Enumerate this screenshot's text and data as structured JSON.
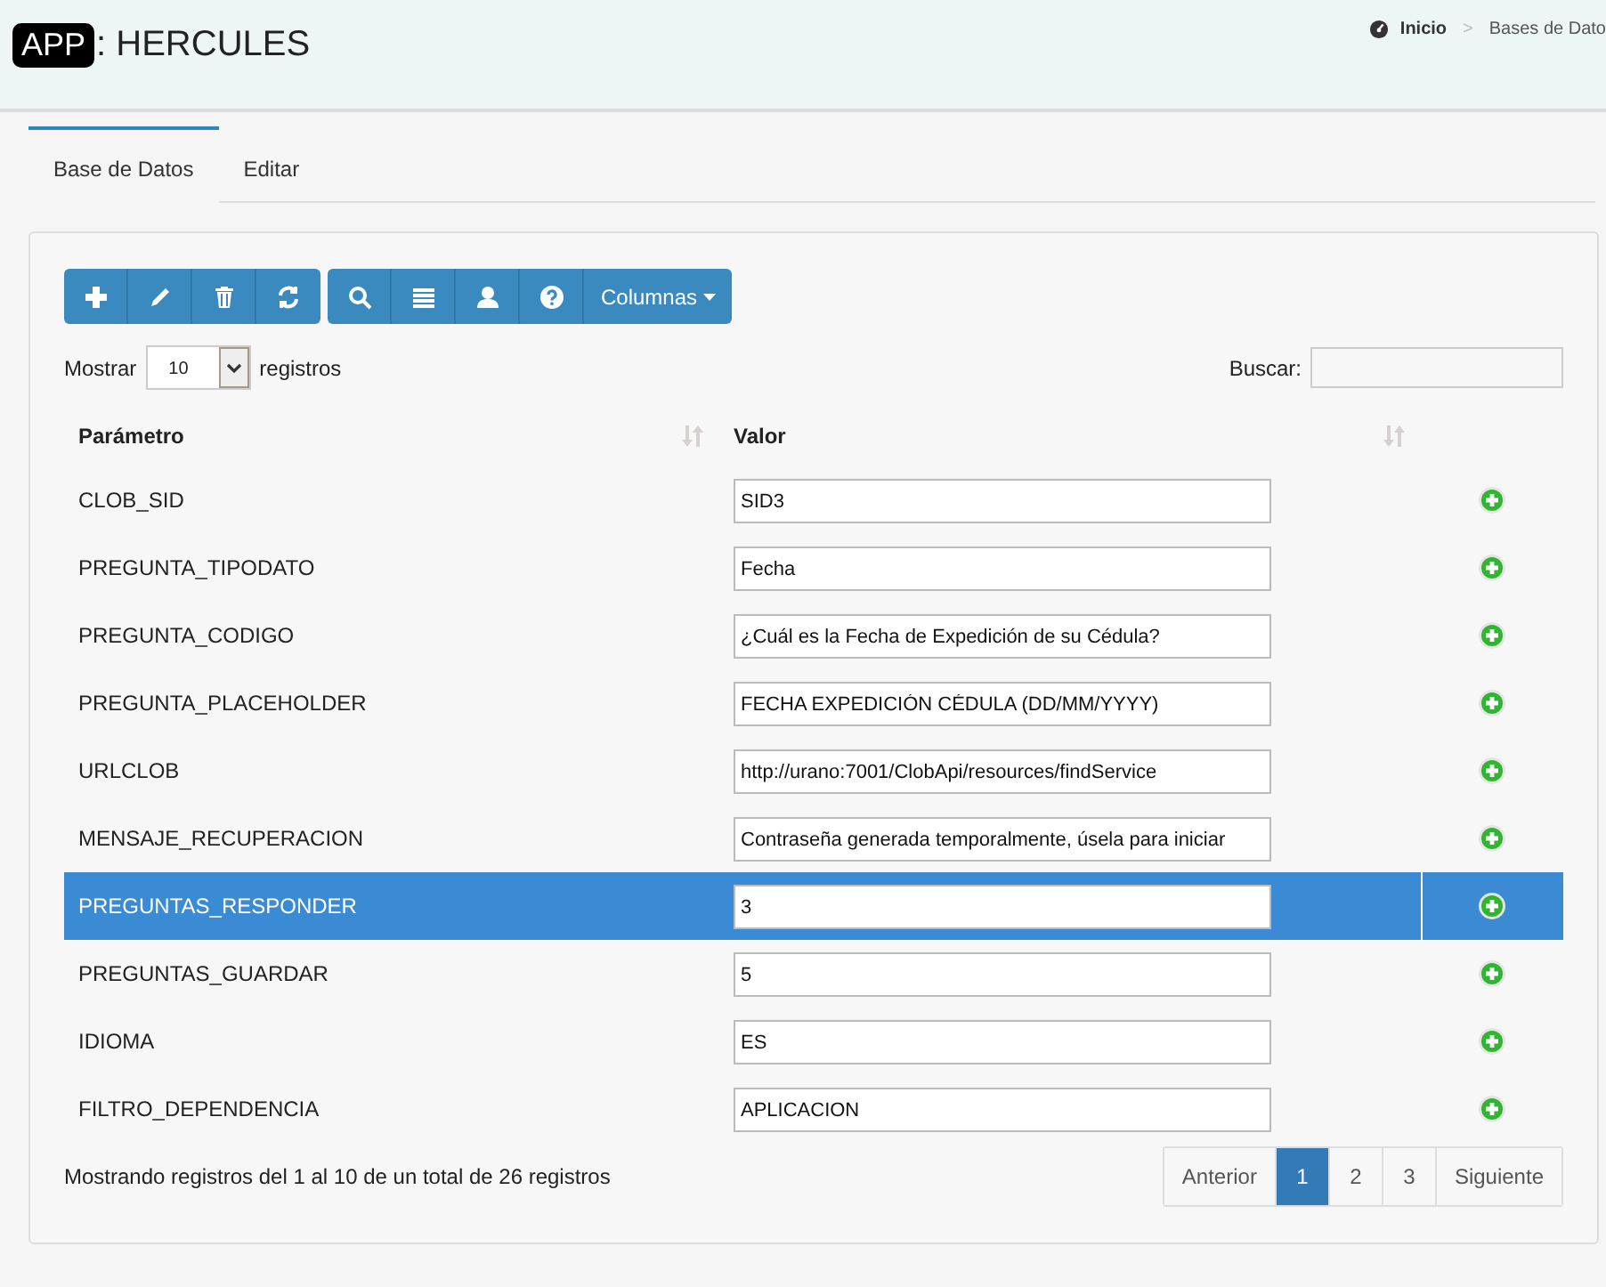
{
  "header": {
    "logo": "APP",
    "title": ": HERCULES",
    "breadcrumb": [
      "Inicio",
      "Bases de Dato"
    ],
    "separator": ">"
  },
  "tabs": [
    {
      "label": "Base de Datos",
      "selected": true
    },
    {
      "label": "Editar",
      "selected": false
    }
  ],
  "toolbar": {
    "groups": [
      [
        {
          "kind": "add"
        },
        {
          "kind": "edit"
        },
        {
          "kind": "delete"
        },
        {
          "kind": "refresh"
        }
      ],
      [
        {
          "kind": "search"
        },
        {
          "kind": "list"
        },
        {
          "kind": "user"
        },
        {
          "kind": "help"
        }
      ]
    ],
    "columns_button": "Columnas"
  },
  "length": {
    "before": "Mostrar",
    "value": "10",
    "after": "registros"
  },
  "search": {
    "label": "Buscar:"
  },
  "table": {
    "columns": [
      "Parámetro",
      "Valor"
    ],
    "rows": [
      {
        "param": "CLOB_SID",
        "value": "SID3",
        "selected": false
      },
      {
        "param": "PREGUNTA_TIPODATO",
        "value": "Fecha",
        "selected": false
      },
      {
        "param": "PREGUNTA_CODIGO",
        "value": "¿Cuál es la Fecha de Expedición de su Cédula?",
        "selected": false
      },
      {
        "param": "PREGUNTA_PLACEHOLDER",
        "value": "FECHA EXPEDICIÓN CÉDULA (DD/MM/YYYY)",
        "selected": false
      },
      {
        "param": "URLCLOB",
        "value": "http://urano:7001/ClobApi/resources/findService",
        "selected": false
      },
      {
        "param": "MENSAJE_RECUPERACION",
        "value": "Contraseña generada temporalmente, úsela para iniciar",
        "selected": false
      },
      {
        "param": "PREGUNTAS_RESPONDER",
        "value": "3",
        "selected": true
      },
      {
        "param": "PREGUNTAS_GUARDAR",
        "value": "5",
        "selected": false
      },
      {
        "param": "IDIOMA",
        "value": "ES",
        "selected": false
      },
      {
        "param": "FILTRO_DEPENDENCIA",
        "value": "APLICACION",
        "selected": false
      }
    ]
  },
  "info": "Mostrando registros del 1 al 10 de un total de 26 registros",
  "pagination": [
    {
      "label": "Anterior",
      "selected": false
    },
    {
      "label": "1",
      "selected": true
    },
    {
      "label": "2",
      "selected": false
    },
    {
      "label": "3",
      "selected": false
    },
    {
      "label": "Siguiente",
      "selected": false
    }
  ]
}
